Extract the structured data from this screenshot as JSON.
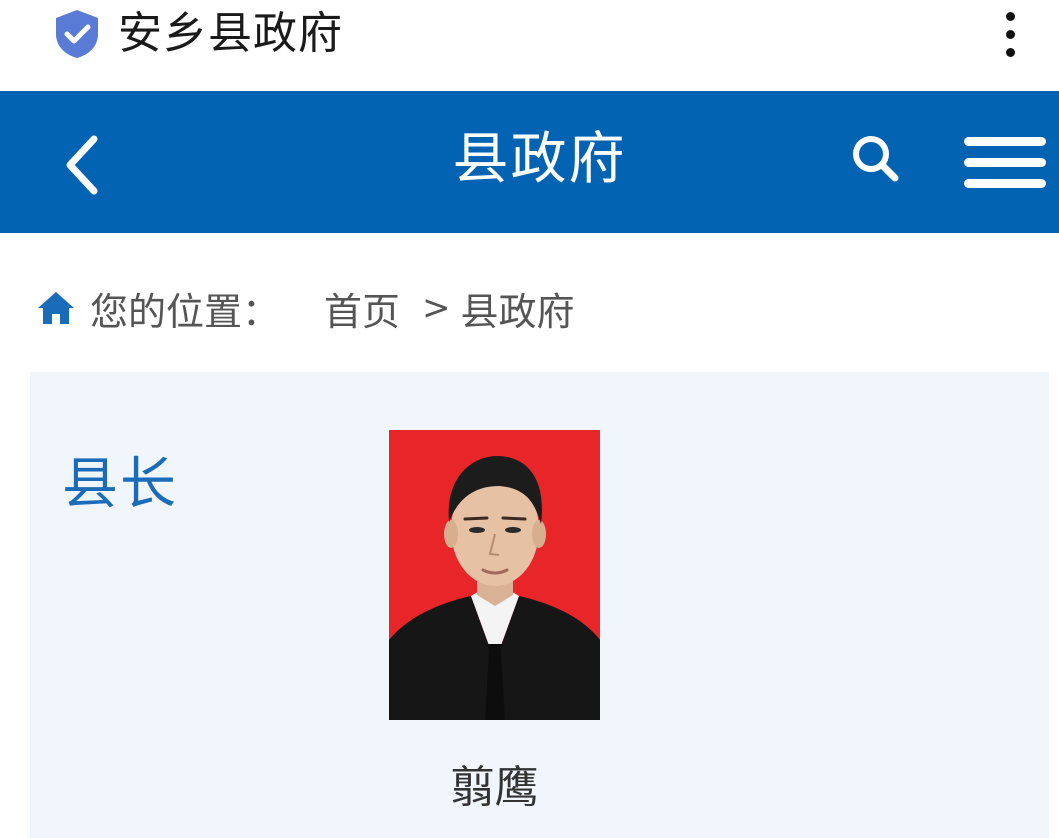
{
  "topbar": {
    "site_title": "安乡县政府",
    "shield_icon": "verified-shield-icon",
    "more_icon": "more-vertical-icon"
  },
  "navbar": {
    "title": "县政府",
    "back_icon": "chevron-left-icon",
    "search_icon": "search-icon",
    "menu_icon": "hamburger-menu-icon",
    "background": "#0363b3"
  },
  "breadcrumb": {
    "label": "您的位置：",
    "items": [
      "首页",
      "县政府"
    ],
    "separator": ">",
    "home_icon": "home-icon"
  },
  "section": {
    "title": "县长",
    "person": {
      "name": "翦鹰",
      "photo_background": "#e8262a"
    },
    "background": "#f1f6fc",
    "title_color": "#1b6cb8"
  }
}
